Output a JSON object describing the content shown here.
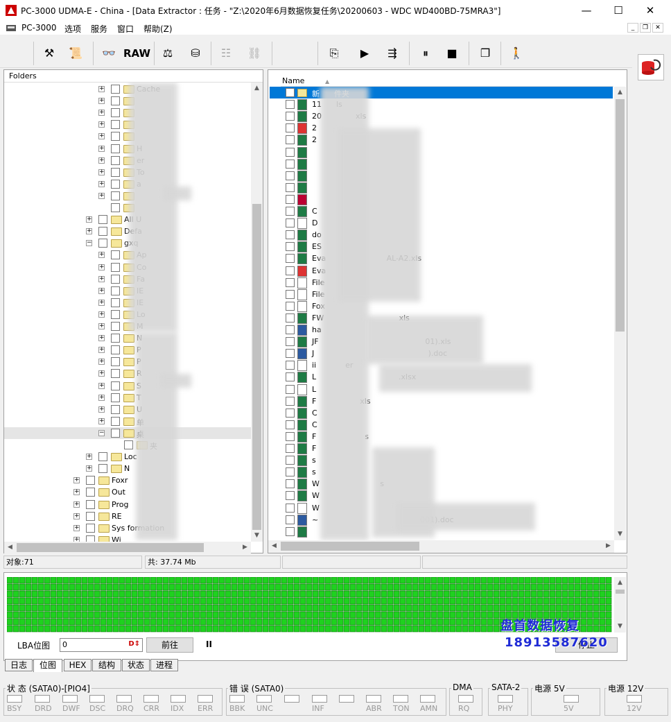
{
  "window": {
    "title": "PC-3000 UDMA-E - China - [Data Extractor : 任务 - \"Z:\\2020年6月数据恢复任务\\20200603 - WDC WD400BD-75MRA3\"]",
    "minimize": "—",
    "maximize": "☐",
    "close": "✕"
  },
  "menu": {
    "items": [
      "PC-3000",
      "选项",
      "服务",
      "窗口",
      "帮助(Z)"
    ]
  },
  "toolbar": {
    "raw_label": "RAW"
  },
  "folders_panel": {
    "header": "Folders",
    "items": [
      {
        "indent": 2,
        "label": "Cache",
        "expander": "+"
      },
      {
        "indent": 2,
        "label": "",
        "expander": "+"
      },
      {
        "indent": 2,
        "label": "",
        "expander": "+"
      },
      {
        "indent": 2,
        "label": "",
        "expander": "+"
      },
      {
        "indent": 2,
        "label": "",
        "expander": "+"
      },
      {
        "indent": 2,
        "label": "H",
        "expander": "+"
      },
      {
        "indent": 2,
        "label": "er",
        "expander": "+"
      },
      {
        "indent": 2,
        "label": "To",
        "expander": "+"
      },
      {
        "indent": 2,
        "label": "a",
        "expander": "+"
      },
      {
        "indent": 2,
        "label": "",
        "expander": "+"
      },
      {
        "indent": 2,
        "label": "",
        "expander": ""
      },
      {
        "indent": 1,
        "label": "All U",
        "expander": "+"
      },
      {
        "indent": 1,
        "label": "Defa",
        "expander": "+"
      },
      {
        "indent": 1,
        "label": "gxq",
        "expander": "−"
      },
      {
        "indent": 2,
        "label": "Ap",
        "expander": "+"
      },
      {
        "indent": 2,
        "label": "Co",
        "expander": "+"
      },
      {
        "indent": 2,
        "label": "Fa",
        "expander": "+"
      },
      {
        "indent": 2,
        "label": "IE",
        "expander": "+"
      },
      {
        "indent": 2,
        "label": "IE",
        "expander": "+"
      },
      {
        "indent": 2,
        "label": "Lo",
        "expander": "+"
      },
      {
        "indent": 2,
        "label": "M",
        "expander": "+"
      },
      {
        "indent": 2,
        "label": "N",
        "expander": "+"
      },
      {
        "indent": 2,
        "label": "P",
        "expander": "+"
      },
      {
        "indent": 2,
        "label": "P",
        "expander": "+"
      },
      {
        "indent": 2,
        "label": "R",
        "expander": "+"
      },
      {
        "indent": 2,
        "label": "S",
        "expander": "+"
      },
      {
        "indent": 2,
        "label": "T",
        "expander": "+"
      },
      {
        "indent": 2,
        "label": "U",
        "expander": "+"
      },
      {
        "indent": 2,
        "label": "单",
        "expander": "+"
      },
      {
        "indent": 2,
        "label": "桌",
        "expander": "−"
      },
      {
        "indent": 3,
        "label": "夹",
        "expander": ""
      },
      {
        "indent": 1,
        "label": "Loc",
        "expander": "+"
      },
      {
        "indent": 1,
        "label": "N",
        "expander": "+"
      },
      {
        "indent": 0,
        "label": "Foxr",
        "expander": "+"
      },
      {
        "indent": 0,
        "label": "Out",
        "expander": "+"
      },
      {
        "indent": 0,
        "label": "Prog",
        "expander": "+"
      },
      {
        "indent": 0,
        "label": "RE",
        "expander": "+"
      },
      {
        "indent": 0,
        "label": "Sys           formation",
        "expander": "+"
      },
      {
        "indent": 0,
        "label": "Wi",
        "expander": "+"
      }
    ]
  },
  "files_panel": {
    "column_name": "Name",
    "files": [
      {
        "name": "新      件夹",
        "type": "folder",
        "selected": true
      },
      {
        "name": "11      ls",
        "type": "xl"
      },
      {
        "name": "20              xls",
        "type": "xl"
      },
      {
        "name": "2",
        "type": "pdf"
      },
      {
        "name": "2",
        "type": "xl"
      },
      {
        "name": "",
        "type": "xl"
      },
      {
        "name": "",
        "type": "xl"
      },
      {
        "name": "",
        "type": "xl"
      },
      {
        "name": "",
        "type": "xl"
      },
      {
        "name": "",
        "type": "img"
      },
      {
        "name": "C",
        "type": "xl"
      },
      {
        "name": "D",
        "type": "gen"
      },
      {
        "name": "do",
        "type": "xl"
      },
      {
        "name": "ES",
        "type": "xl"
      },
      {
        "name": "Eva                         AL-A2.xls",
        "type": "xl"
      },
      {
        "name": "Eva",
        "type": "pdf"
      },
      {
        "name": "File",
        "type": "gen"
      },
      {
        "name": "File",
        "type": "gen"
      },
      {
        "name": "Fox",
        "type": "gen"
      },
      {
        "name": "FW                               xls",
        "type": "xl"
      },
      {
        "name": "ha",
        "type": "doc"
      },
      {
        "name": "JF                                            01).xls",
        "type": "xl"
      },
      {
        "name": "J                                               ).doc",
        "type": "doc"
      },
      {
        "name": "ii            er",
        "type": "gen"
      },
      {
        "name": "L                                  .xlsx",
        "type": "xl"
      },
      {
        "name": "L",
        "type": "gen"
      },
      {
        "name": "F                  xls",
        "type": "xl"
      },
      {
        "name": "C",
        "type": "xl"
      },
      {
        "name": "C",
        "type": "xl"
      },
      {
        "name": "F                    s",
        "type": "xl"
      },
      {
        "name": "F",
        "type": "xl"
      },
      {
        "name": "s",
        "type": "xl"
      },
      {
        "name": "s",
        "type": "xl"
      },
      {
        "name": "W                         s",
        "type": "xl"
      },
      {
        "name": "W",
        "type": "xl"
      },
      {
        "name": "W",
        "type": "gen"
      },
      {
        "name": "~                                          001).doc",
        "type": "doc"
      },
      {
        "name": "",
        "type": "xl"
      }
    ]
  },
  "status": {
    "objects": "对象:71",
    "total": "共: 37.74 Mb"
  },
  "map": {
    "lba_label": "LBA位图",
    "lba_value": "0",
    "goto_button": "前往",
    "pause_icon": "II",
    "stop_button": "停止"
  },
  "tabs": [
    "日志",
    "位图",
    "HEX",
    "结构",
    "状态",
    "进程"
  ],
  "indicators": {
    "groups": [
      {
        "title": "状 态 (SATA0)-[PIO4]",
        "leds": [
          "BSY",
          "DRD",
          "DWF",
          "DSC",
          "DRQ",
          "CRR",
          "IDX",
          "ERR"
        ]
      },
      {
        "title": "错 误 (SATA0)",
        "leds": [
          "BBK",
          "UNC",
          "",
          "INF",
          "",
          "ABR",
          "TON",
          "AMN"
        ]
      },
      {
        "title": "DMA",
        "leds": [
          "RQ"
        ]
      },
      {
        "title": "SATA-2",
        "leds": [
          "PHY"
        ]
      },
      {
        "title": "电源 5V",
        "leds": [
          "5V"
        ]
      },
      {
        "title": "电源 12V",
        "leds": [
          "12V"
        ]
      }
    ]
  },
  "watermark": {
    "line1": "盘首数据恢复",
    "line2": "18913587620"
  },
  "colors": {
    "grid_green": "#1fd11f",
    "selection": "#0078d7",
    "watermark": "#1f2bd6"
  }
}
